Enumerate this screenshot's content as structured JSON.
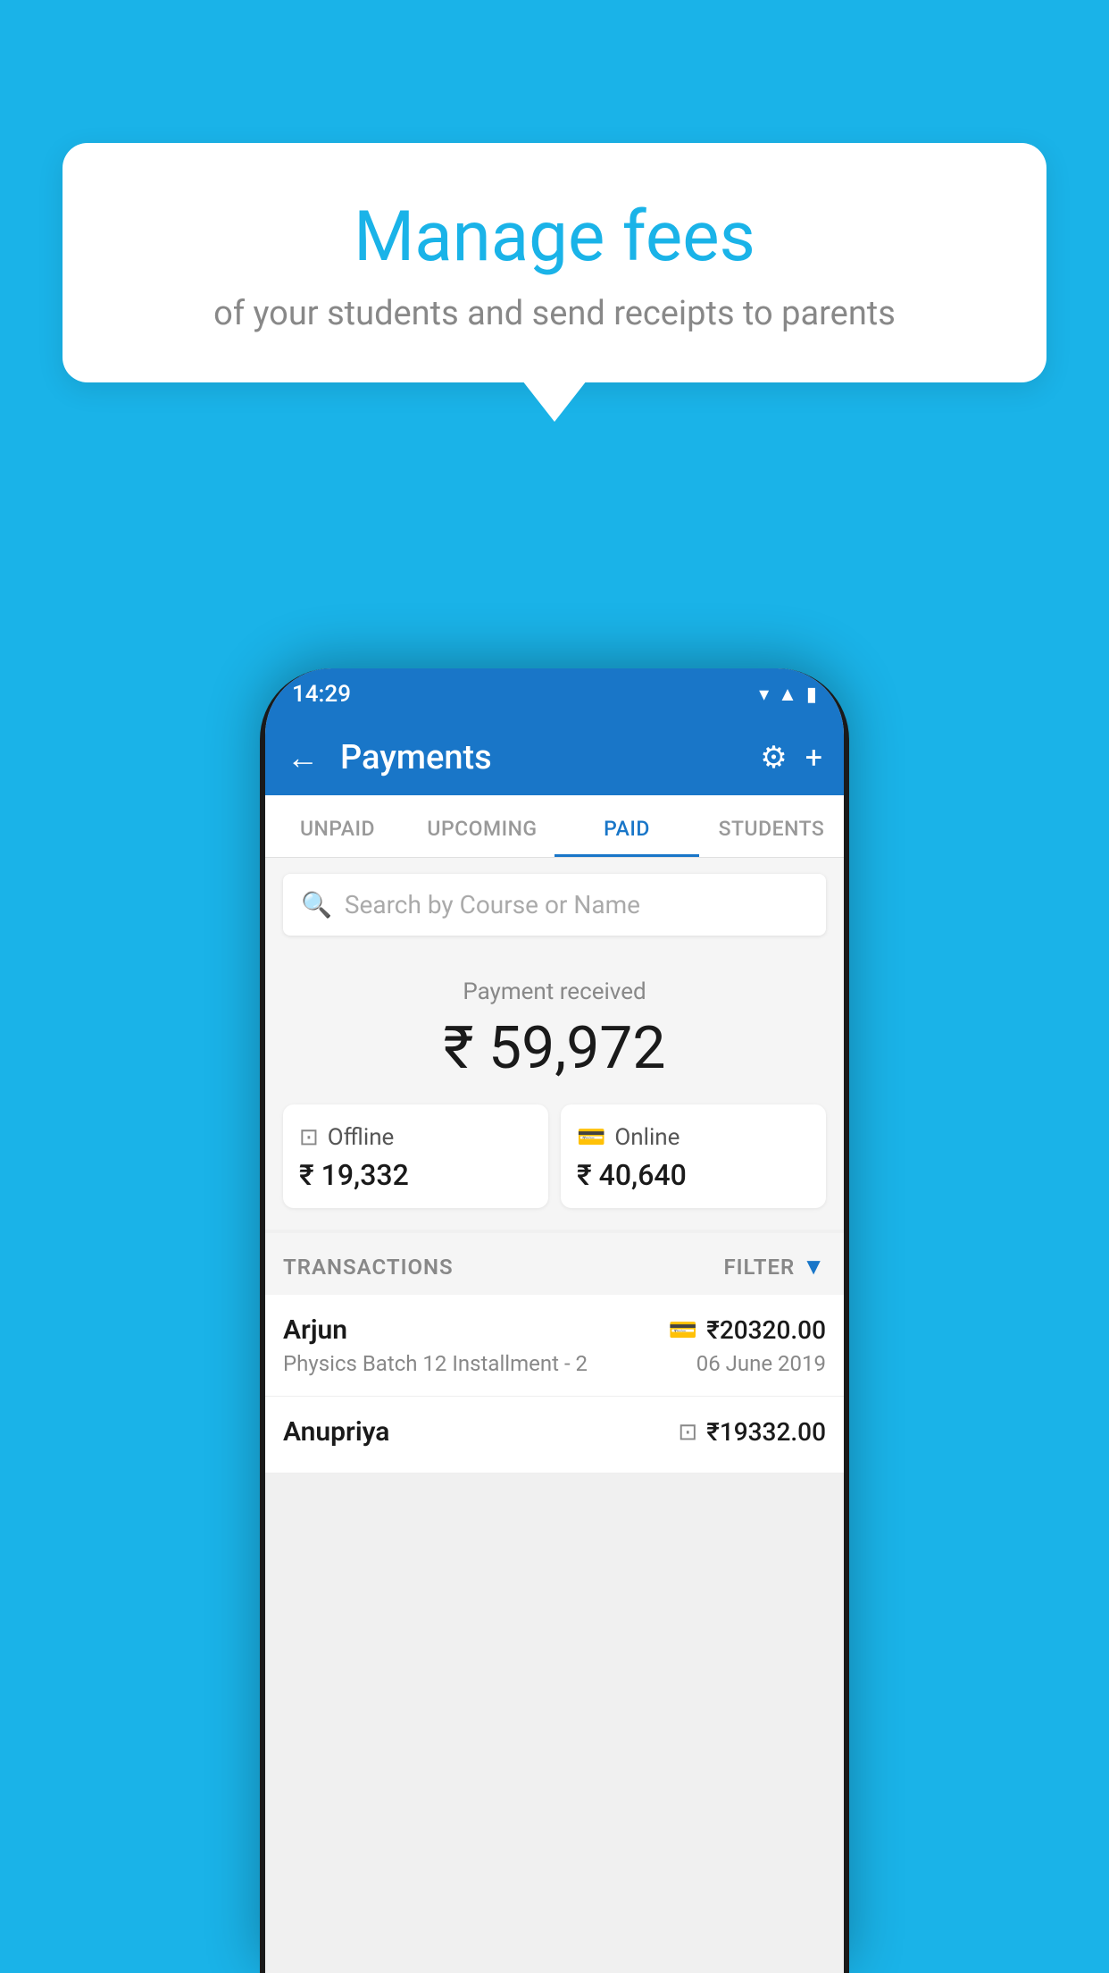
{
  "background_color": "#1ab3e8",
  "speech_bubble": {
    "title": "Manage fees",
    "subtitle": "of your students and send receipts to parents"
  },
  "status_bar": {
    "time": "14:29",
    "icons": [
      "wifi",
      "signal",
      "battery"
    ]
  },
  "header": {
    "title": "Payments",
    "back_label": "←",
    "settings_label": "⚙",
    "add_label": "+"
  },
  "tabs": [
    {
      "label": "UNPAID",
      "active": false
    },
    {
      "label": "UPCOMING",
      "active": false
    },
    {
      "label": "PAID",
      "active": true
    },
    {
      "label": "STUDENTS",
      "active": false
    }
  ],
  "search": {
    "placeholder": "Search by Course or Name"
  },
  "payment_summary": {
    "received_label": "Payment received",
    "total_amount": "₹ 59,972",
    "offline": {
      "label": "Offline",
      "amount": "₹ 19,332"
    },
    "online": {
      "label": "Online",
      "amount": "₹ 40,640"
    }
  },
  "transactions": {
    "header_label": "TRANSACTIONS",
    "filter_label": "FILTER",
    "rows": [
      {
        "name": "Arjun",
        "course": "Physics Batch 12 Installment - 2",
        "amount": "₹20320.00",
        "date": "06 June 2019",
        "payment_type": "card"
      },
      {
        "name": "Anupriya",
        "course": "",
        "amount": "₹19332.00",
        "date": "",
        "payment_type": "offline"
      }
    ]
  }
}
